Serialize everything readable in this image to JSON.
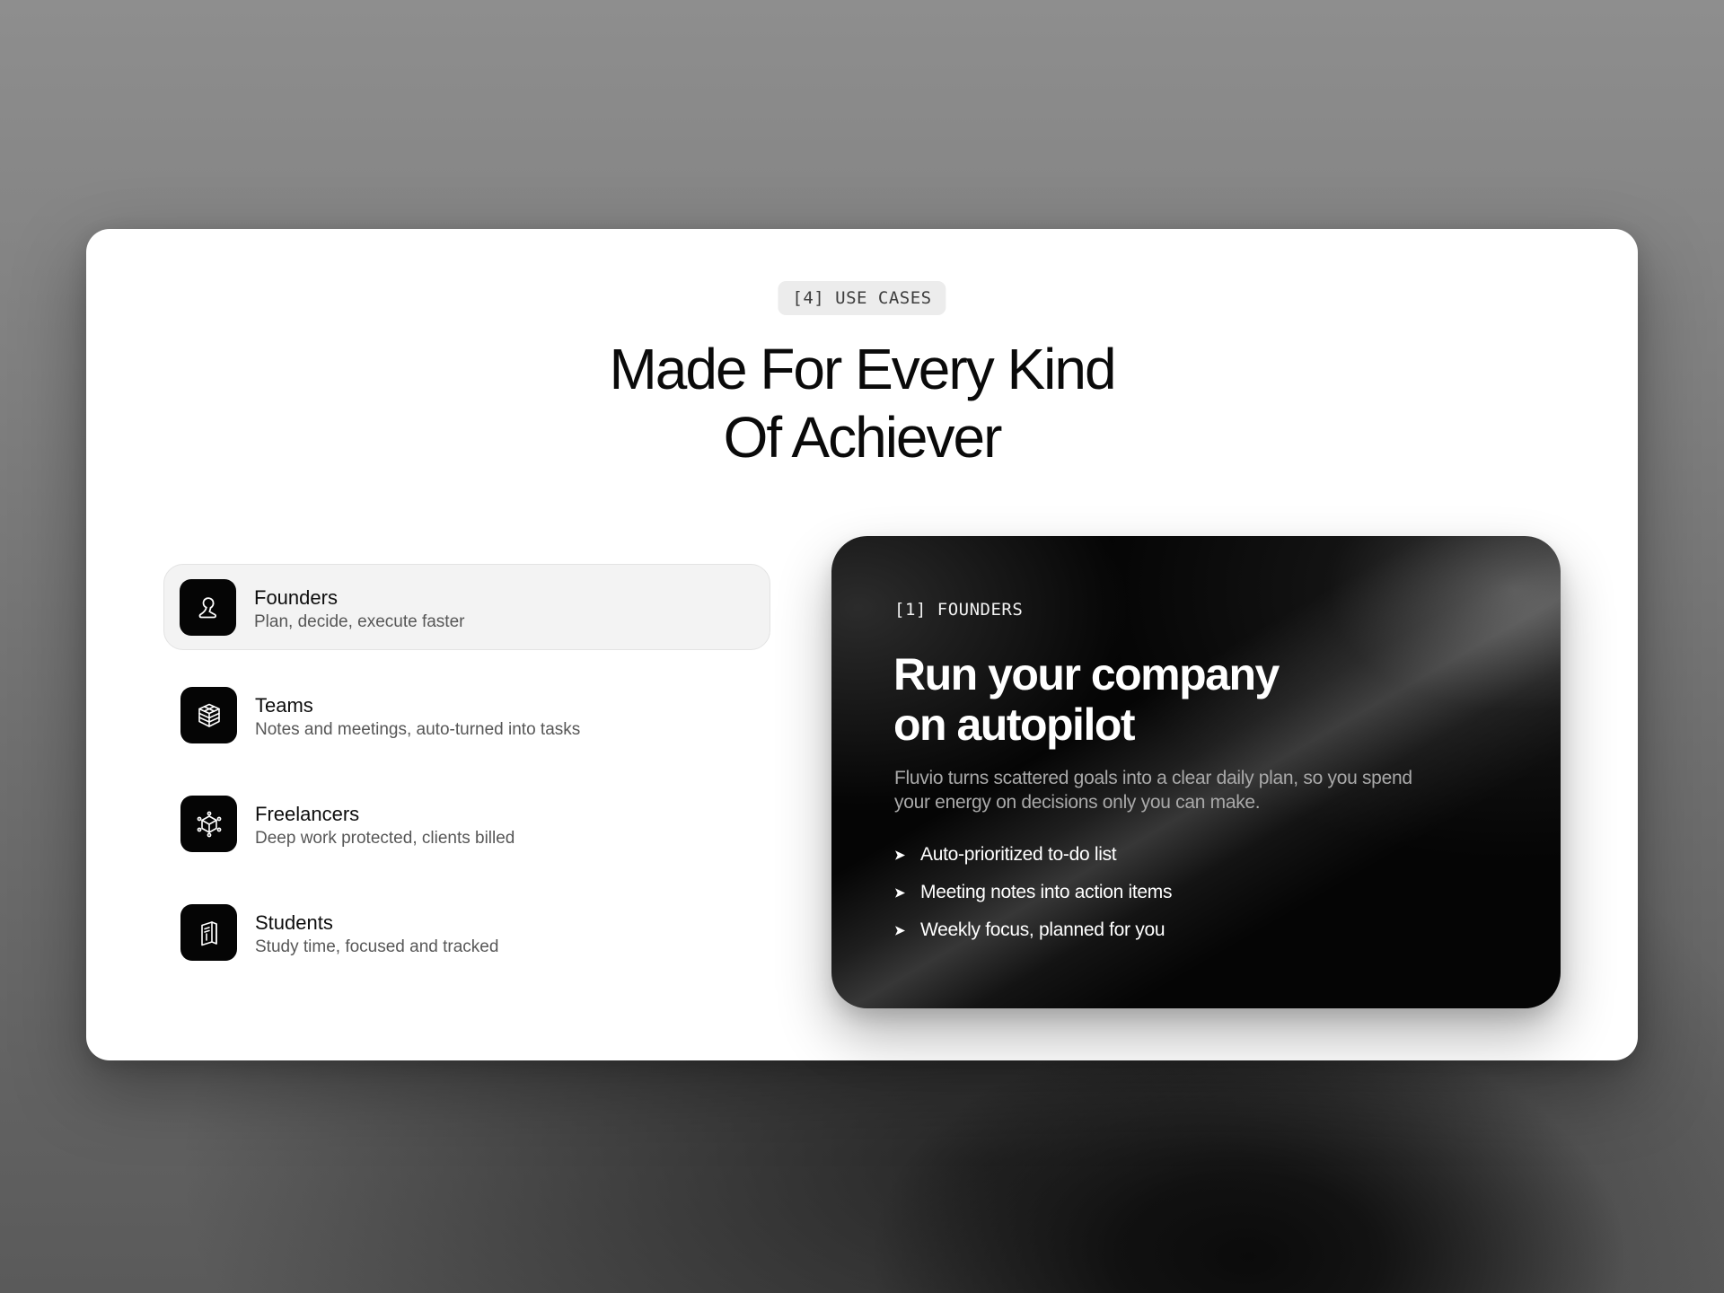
{
  "section": {
    "badge": "[4] USE CASES",
    "headline_line1": "Made For Every Kind",
    "headline_line2": "Of Achiever"
  },
  "use_cases": [
    {
      "title": "Founders",
      "subtitle": "Plan, decide, execute faster",
      "icon": "founder-person-icon",
      "active": true
    },
    {
      "title": "Teams",
      "subtitle": "Notes and meetings, auto-turned into tasks",
      "icon": "stack-cube-icon",
      "active": false
    },
    {
      "title": "Freelancers",
      "subtitle": "Deep work protected, clients billed",
      "icon": "network-cube-icon",
      "active": false
    },
    {
      "title": "Students",
      "subtitle": "Study time, focused and tracked",
      "icon": "book-icon",
      "active": false
    }
  ],
  "detail_card": {
    "eyebrow": "[1] FOUNDERS",
    "title_line1": "Run your company",
    "title_line2": "on autopilot",
    "description": "Fluvio turns scattered goals into a clear daily plan, so you spend your energy on decisions only you can make.",
    "bullets": [
      "Auto-prioritized to-do list",
      "Meeting notes into action items",
      "Weekly focus, planned for you"
    ]
  },
  "colors": {
    "panel_background": "#ffffff",
    "card_background": "#050505",
    "icon_tile": "#050505",
    "active_item_background": "#f3f3f3",
    "badge_background": "#ececec"
  }
}
